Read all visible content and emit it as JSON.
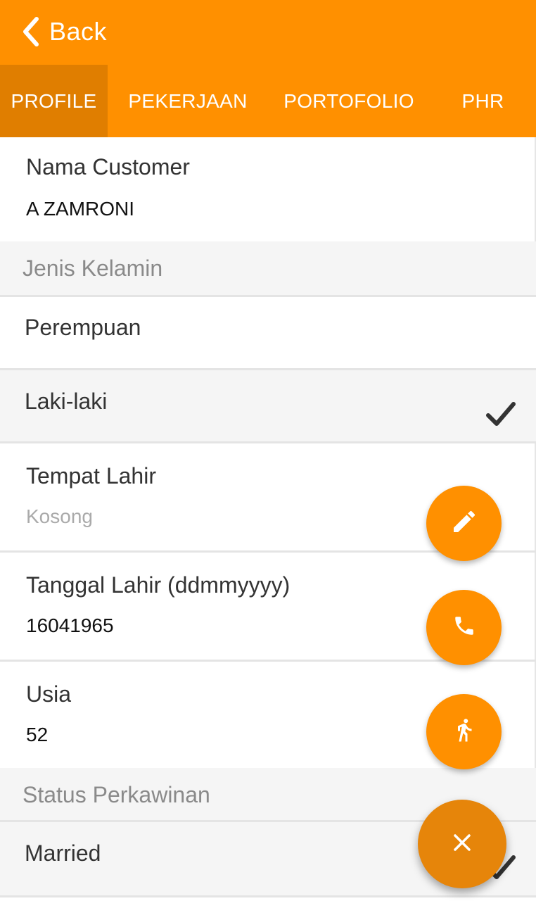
{
  "app_bar": {
    "back_label": "Back"
  },
  "tabs": [
    {
      "label": "PROFILE",
      "active": true
    },
    {
      "label": "PEKERJAAN",
      "active": false
    },
    {
      "label": "PORTOFOLIO",
      "active": false
    },
    {
      "label": "PHR",
      "active": false
    }
  ],
  "profile": {
    "nama_customer": {
      "label": "Nama Customer",
      "value": "A  ZAMRONI"
    },
    "jenis_kelamin": {
      "header": "Jenis Kelamin",
      "options": [
        {
          "label": "Perempuan",
          "selected": false
        },
        {
          "label": "Laki-laki",
          "selected": true
        }
      ]
    },
    "tempat_lahir": {
      "label": "Tempat Lahir",
      "placeholder": "Kosong"
    },
    "tanggal_lahir": {
      "label": "Tanggal Lahir (ddmmyyyy)",
      "value": "16041965"
    },
    "usia": {
      "label": "Usia",
      "value": "52"
    },
    "status_perkawinan": {
      "header": "Status Perkawinan",
      "options": [
        {
          "label": "Married",
          "selected": true
        }
      ]
    }
  },
  "fab_actions": [
    {
      "icon": "pencil-icon"
    },
    {
      "icon": "phone-icon"
    },
    {
      "icon": "walking-person-icon"
    },
    {
      "icon": "close-icon"
    }
  ],
  "colors": {
    "primary": "#FF9000",
    "tab_active": "#E07E00",
    "fab_main": "#E6850A",
    "section_bg": "#F5F5F5",
    "muted_text": "#8A8A8A"
  }
}
